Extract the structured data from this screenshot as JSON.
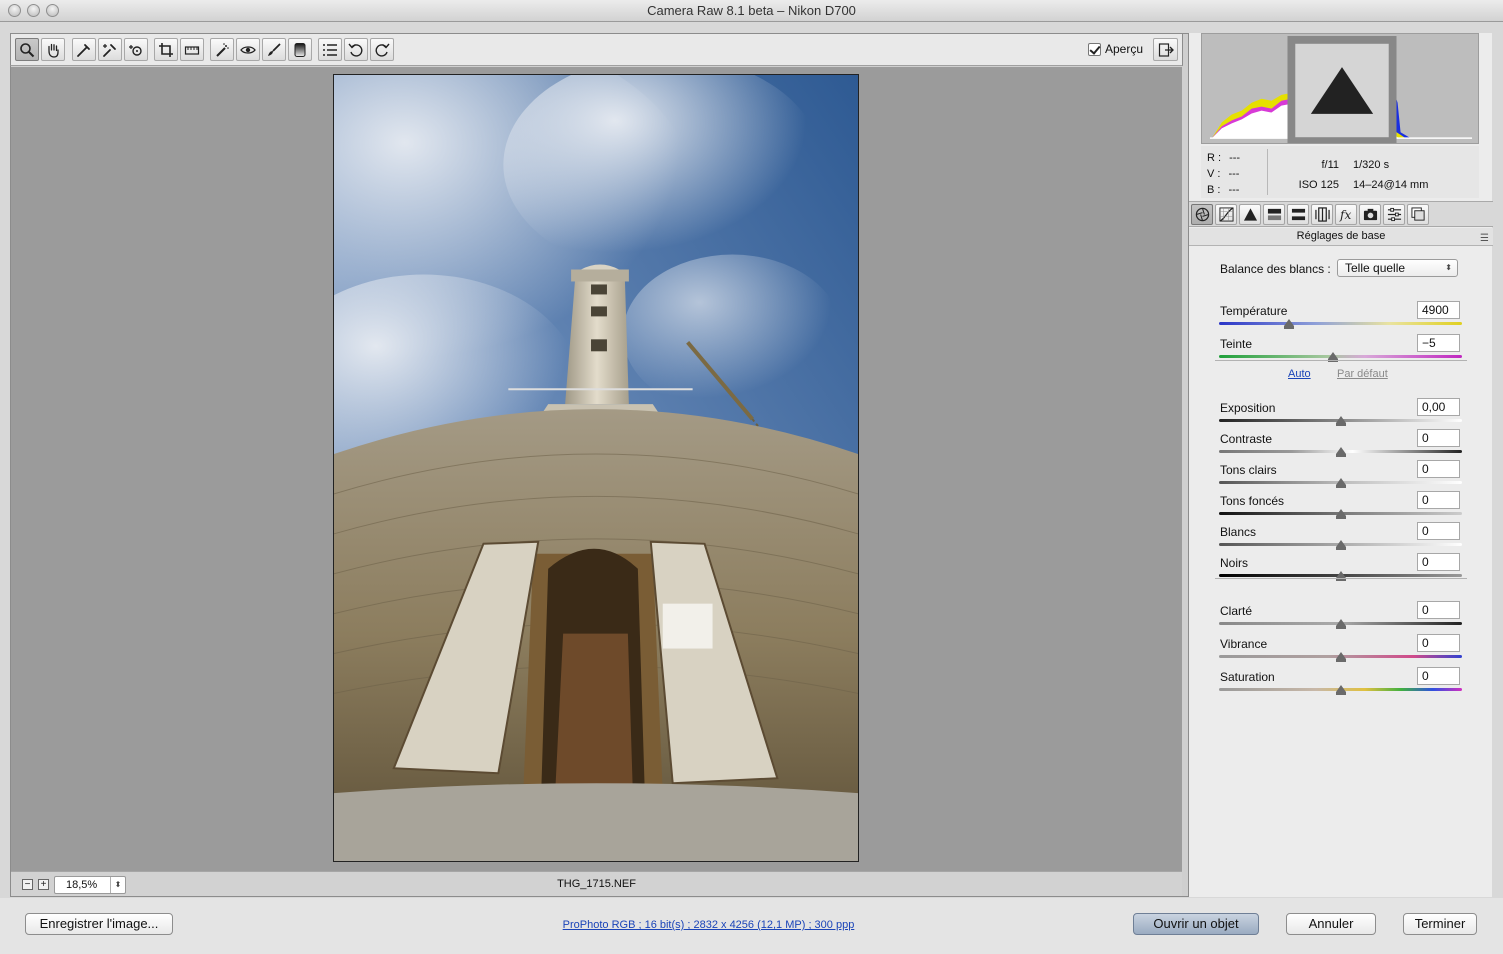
{
  "window": {
    "title": "Camera Raw 8.1 beta  –  Nikon D700"
  },
  "toolbar": {
    "tools": [
      "zoom-tool-icon",
      "hand-tool-icon",
      "white-balance-tool-icon",
      "color-sampler-tool-icon",
      "targeted-adjustment-tool-icon",
      "crop-tool-icon",
      "straighten-tool-icon",
      "spot-removal-tool-icon",
      "red-eye-tool-icon",
      "adjustment-brush-icon",
      "graduated-filter-icon",
      "preferences-icon",
      "rotate-left-icon",
      "rotate-right-icon"
    ],
    "preview_label": "Aperçu",
    "preview_checked": true
  },
  "histogram": {
    "clip_shadows_icon": "triangle-up-icon",
    "clip_highlights_icon": "triangle-up-icon"
  },
  "readout": {
    "r_label": "R :",
    "r_value": "---",
    "v_label": "V :",
    "v_value": "---",
    "b_label": "B :",
    "b_value": "---",
    "aperture": "f/11",
    "shutter": "1/320 s",
    "iso": "ISO 125",
    "lens": "14–24@14 mm"
  },
  "panel": {
    "title": "Réglages de base",
    "wb_label": "Balance des blancs :",
    "wb_value": "Telle quelle",
    "auto": "Auto",
    "default": "Par défaut",
    "sliders": [
      {
        "id": "temperature",
        "label": "Température",
        "value": "4900",
        "pos": 0.29
      },
      {
        "id": "teinte",
        "label": "Teinte",
        "value": "−5",
        "pos": 0.47
      },
      {
        "id": "exposition",
        "label": "Exposition",
        "value": "0,00",
        "pos": 0.5
      },
      {
        "id": "contraste",
        "label": "Contraste",
        "value": "0",
        "pos": 0.5
      },
      {
        "id": "tons-clairs",
        "label": "Tons clairs",
        "value": "0",
        "pos": 0.5
      },
      {
        "id": "tons-fonces",
        "label": "Tons foncés",
        "value": "0",
        "pos": 0.5
      },
      {
        "id": "blancs",
        "label": "Blancs",
        "value": "0",
        "pos": 0.5
      },
      {
        "id": "noirs",
        "label": "Noirs",
        "value": "0",
        "pos": 0.5
      },
      {
        "id": "clarte",
        "label": "Clarté",
        "value": "0",
        "pos": 0.5
      },
      {
        "id": "vibrance",
        "label": "Vibrance",
        "value": "0",
        "pos": 0.5
      },
      {
        "id": "saturation",
        "label": "Saturation",
        "value": "0",
        "pos": 0.5
      }
    ]
  },
  "status": {
    "zoom": "18,5%",
    "filename": "THG_1715.NEF"
  },
  "bottom": {
    "save": "Enregistrer l'image...",
    "workflow": "ProPhoto RGB ; 16 bit(s) ; 2832 x 4256 (12,1 MP) ; 300 ppp",
    "open_object": "Ouvrir un objet",
    "cancel": "Annuler",
    "done": "Terminer"
  }
}
